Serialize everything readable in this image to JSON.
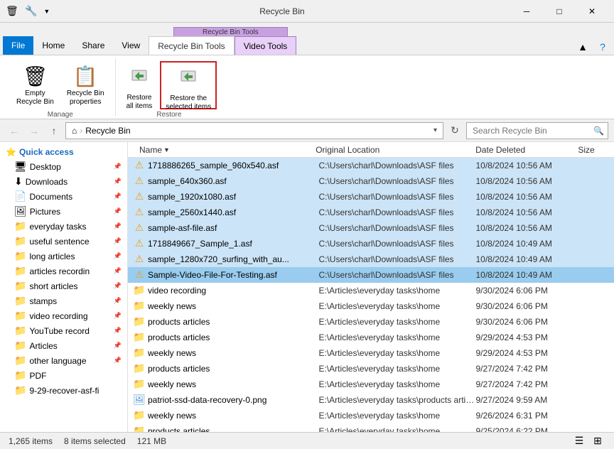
{
  "titleBar": {
    "title": "Recycle Bin",
    "icon": "🗑",
    "minBtn": "─",
    "maxBtn": "□",
    "closeBtn": "✕"
  },
  "ribbon": {
    "contextGroupManageLabel": "Recycle Bin Tools",
    "contextGroupManageColor": "#c8a0e8",
    "tabs": [
      {
        "label": "File",
        "type": "file"
      },
      {
        "label": "Home",
        "type": "normal"
      },
      {
        "label": "Share",
        "type": "normal"
      },
      {
        "label": "View",
        "type": "normal"
      },
      {
        "label": "Recycle Bin Tools",
        "type": "context-active"
      },
      {
        "label": "Video Tools",
        "type": "context"
      }
    ],
    "activeTab": "Recycle Bin Tools",
    "groups": [
      {
        "name": "Manage",
        "items": [
          {
            "id": "empty-recycle-bin",
            "icon": "🗑",
            "label": "Empty\nRecycle Bin"
          },
          {
            "id": "recycle-bin-properties",
            "icon": "📋",
            "label": "Recycle Bin\nproperties"
          }
        ]
      },
      {
        "name": "Restore",
        "items": [
          {
            "id": "restore-all",
            "icon": "↩",
            "label": "Restore\nall items"
          },
          {
            "id": "restore-selected",
            "icon": "↩",
            "label": "Restore the\nselected items",
            "selected": true
          }
        ]
      }
    ]
  },
  "addressBar": {
    "backLabel": "←",
    "forwardLabel": "→",
    "upLabel": "↑",
    "homeIcon": "⌂",
    "path": "Recycle Bin",
    "dropdownLabel": "▼",
    "refreshLabel": "↻",
    "searchPlaceholder": "Search Recycle Bin"
  },
  "columns": [
    {
      "id": "name",
      "label": "Name",
      "sorted": true,
      "sortDir": "asc"
    },
    {
      "id": "location",
      "label": "Original Location"
    },
    {
      "id": "deleted",
      "label": "Date Deleted"
    },
    {
      "id": "size",
      "label": "Size"
    }
  ],
  "sidebar": {
    "quickAccessLabel": "⭐ Quick access",
    "items": [
      {
        "label": "Desktop",
        "icon": "🖥",
        "pinned": true
      },
      {
        "label": "Downloads",
        "icon": "⬇",
        "pinned": true
      },
      {
        "label": "Documents",
        "icon": "📄",
        "pinned": true
      },
      {
        "label": "Pictures",
        "icon": "🖼",
        "pinned": true
      },
      {
        "label": "everyday tasks",
        "icon": "📁",
        "pinned": true
      },
      {
        "label": "useful sentence",
        "icon": "📁",
        "pinned": true
      },
      {
        "label": "long articles",
        "icon": "📁",
        "pinned": true
      },
      {
        "label": "articles recordin",
        "icon": "📁",
        "pinned": true
      },
      {
        "label": "short articles",
        "icon": "📁",
        "pinned": true
      },
      {
        "label": "stamps",
        "icon": "📁",
        "pinned": true
      },
      {
        "label": "video recording",
        "icon": "📁",
        "pinned": true
      },
      {
        "label": "YouTube record",
        "icon": "📁",
        "pinned": true
      },
      {
        "label": "Articles",
        "icon": "📁",
        "pinned": true
      },
      {
        "label": "other language",
        "icon": "📁",
        "pinned": true
      },
      {
        "label": "PDF",
        "icon": "📁",
        "pinned": false
      },
      {
        "label": "9-29-recover-asf-fi",
        "icon": "📁",
        "pinned": false
      }
    ]
  },
  "files": [
    {
      "name": "1718886265_sample_960x540.asf",
      "location": "C:\\Users\\charl\\Downloads\\ASF files",
      "deleted": "10/8/2024 10:56 AM",
      "size": "",
      "type": "asf",
      "selected": true
    },
    {
      "name": "sample_640x360.asf",
      "location": "C:\\Users\\charl\\Downloads\\ASF files",
      "deleted": "10/8/2024 10:56 AM",
      "size": "",
      "type": "asf",
      "selected": true
    },
    {
      "name": "sample_1920x1080.asf",
      "location": "C:\\Users\\charl\\Downloads\\ASF files",
      "deleted": "10/8/2024 10:56 AM",
      "size": "",
      "type": "asf",
      "selected": true
    },
    {
      "name": "sample_2560x1440.asf",
      "location": "C:\\Users\\charl\\Downloads\\ASF files",
      "deleted": "10/8/2024 10:56 AM",
      "size": "",
      "type": "asf",
      "selected": true
    },
    {
      "name": "sample-asf-file.asf",
      "location": "C:\\Users\\charl\\Downloads\\ASF files",
      "deleted": "10/8/2024 10:56 AM",
      "size": "",
      "type": "asf",
      "selected": true
    },
    {
      "name": "1718849667_Sample_1.asf",
      "location": "C:\\Users\\charl\\Downloads\\ASF files",
      "deleted": "10/8/2024 10:49 AM",
      "size": "",
      "type": "asf",
      "selected": true
    },
    {
      "name": "sample_1280x720_surfing_with_au...",
      "location": "C:\\Users\\charl\\Downloads\\ASF files",
      "deleted": "10/8/2024 10:49 AM",
      "size": "",
      "type": "asf",
      "selected": true
    },
    {
      "name": "Sample-Video-File-For-Testing.asf",
      "location": "C:\\Users\\charl\\Downloads\\ASF files",
      "deleted": "10/8/2024 10:49 AM",
      "size": "",
      "type": "asf",
      "selected": true,
      "primary": true
    },
    {
      "name": "video recording",
      "location": "E:\\Articles\\everyday tasks\\home",
      "deleted": "9/30/2024 6:06 PM",
      "size": "",
      "type": "folder",
      "selected": false
    },
    {
      "name": "weekly news",
      "location": "E:\\Articles\\everyday tasks\\home",
      "deleted": "9/30/2024 6:06 PM",
      "size": "",
      "type": "folder",
      "selected": false
    },
    {
      "name": "products articles",
      "location": "E:\\Articles\\everyday tasks\\home",
      "deleted": "9/30/2024 6:06 PM",
      "size": "",
      "type": "folder",
      "selected": false
    },
    {
      "name": "products articles",
      "location": "E:\\Articles\\everyday tasks\\home",
      "deleted": "9/29/2024 4:53 PM",
      "size": "",
      "type": "folder",
      "selected": false
    },
    {
      "name": "weekly news",
      "location": "E:\\Articles\\everyday tasks\\home",
      "deleted": "9/29/2024 4:53 PM",
      "size": "",
      "type": "folder",
      "selected": false
    },
    {
      "name": "products articles",
      "location": "E:\\Articles\\everyday tasks\\home",
      "deleted": "9/27/2024 7:42 PM",
      "size": "",
      "type": "folder",
      "selected": false
    },
    {
      "name": "weekly news",
      "location": "E:\\Articles\\everyday tasks\\home",
      "deleted": "9/27/2024 7:42 PM",
      "size": "",
      "type": "folder",
      "selected": false
    },
    {
      "name": "patriot-ssd-data-recovery-0.png",
      "location": "E:\\Articles\\everyday tasks\\products articl...",
      "deleted": "9/27/2024 9:59 AM",
      "size": "",
      "type": "image",
      "selected": false
    },
    {
      "name": "weekly news",
      "location": "E:\\Articles\\everyday tasks\\home",
      "deleted": "9/26/2024 6:31 PM",
      "size": "",
      "type": "folder",
      "selected": false
    },
    {
      "name": "products articles",
      "location": "E:\\Articles\\everyday tasks\\home",
      "deleted": "9/25/2024 6:22 PM",
      "size": "",
      "type": "folder",
      "selected": false
    }
  ],
  "statusBar": {
    "count": "1,265 items",
    "selected": "8 items selected",
    "size": "121 MB"
  }
}
